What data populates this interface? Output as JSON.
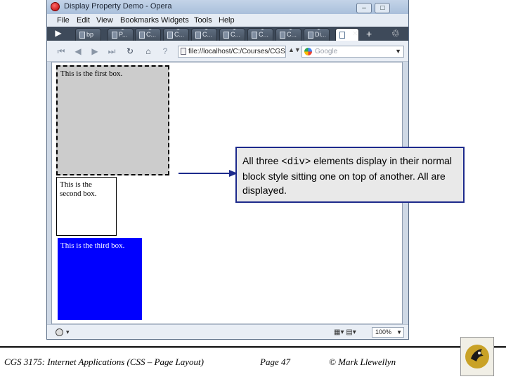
{
  "window": {
    "title": "Display Property Demo - Opera",
    "controls": {
      "minimize": "–",
      "maximize": "□",
      "close": "✕"
    }
  },
  "menu": [
    "File",
    "Edit",
    "View",
    "Bookmarks",
    "Widgets",
    "Tools",
    "Help"
  ],
  "tabs": [
    {
      "label": "bp",
      "active": false
    },
    {
      "label": "P...",
      "active": false
    },
    {
      "label": "C...",
      "active": false
    },
    {
      "label": "C...",
      "active": false
    },
    {
      "label": "C...",
      "active": false
    },
    {
      "label": "C...",
      "active": false
    },
    {
      "label": "C...",
      "active": false
    },
    {
      "label": "C...",
      "active": false
    },
    {
      "label": "Di...",
      "active": false
    },
    {
      "label": "",
      "active": true
    }
  ],
  "toolbar": {
    "address": "file://localhost/C:/Courses/CGS%",
    "search_placeholder": "Google"
  },
  "page": {
    "box1": "This is the first box.",
    "box2": "This is the second box.",
    "box3": "This is the third box."
  },
  "statusbar": {
    "zoom": "100%"
  },
  "callout": {
    "part1": "All three ",
    "code": "<div>",
    "part2": " elements display in their normal block style sitting one on top of another.  All are displayed."
  },
  "footer": {
    "course": "CGS 3175: Internet Applications (CSS – Page Layout)",
    "page": "Page 47",
    "author": "© Mark Llewellyn"
  }
}
